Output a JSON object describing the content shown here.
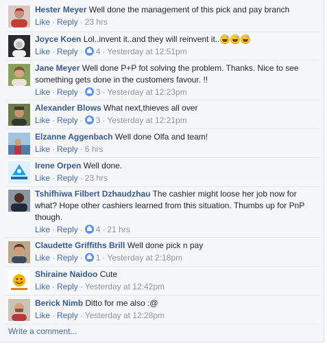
{
  "comments": [
    {
      "author": "Hester Meyer",
      "text": "Well done the management of this pick and pay branch",
      "like_label": "Like",
      "reply_label": "Reply",
      "likes": null,
      "time": "23 hrs"
    },
    {
      "author": "Joyce Koen",
      "text": "Lol..invent it..and they will reinvent it..",
      "like_label": "Like",
      "reply_label": "Reply",
      "likes": "4",
      "time": "Yesterday at 12:51pm",
      "emoji_icons": [
        "grinning-sweat-emoji",
        "grinning-sweat-emoji",
        "grinning-sweat-emoji"
      ]
    },
    {
      "author": "Jane Meyer",
      "text": "Well done P+P fot solving the problem. Thanks. Nice to see something gets done in the customers favour. !!",
      "like_label": "Like",
      "reply_label": "Reply",
      "likes": "3",
      "time": "Yesterday at 12:23pm"
    },
    {
      "author": "Alexander Blows",
      "text": "What next,thieves all over",
      "like_label": "Like",
      "reply_label": "Reply",
      "likes": "3",
      "time": "Yesterday at 12:21pm"
    },
    {
      "author": "Elzanne Aggenbach",
      "text": "Well done Olfa and team!",
      "like_label": "Like",
      "reply_label": "Reply",
      "likes": null,
      "time": "6 hrs"
    },
    {
      "author": "Irene Orpen",
      "text": "Well done.",
      "like_label": "Like",
      "reply_label": "Reply",
      "likes": null,
      "time": "23 hrs"
    },
    {
      "author": "Tshifhiwa Filbert Dzhaudzhau",
      "text": "The cashier might loose her job now for what? Hope other cashiers learned from this situation. Thumbs up for PnP though.",
      "like_label": "Like",
      "reply_label": "Reply",
      "likes": "4",
      "time": "21 hrs"
    },
    {
      "author": "Claudette Griffiths Brill",
      "text": "Well done pick n pay",
      "like_label": "Like",
      "reply_label": "Reply",
      "likes": "1",
      "time": "Yesterday at 2:18pm"
    },
    {
      "author": "Shiraine Naidoo",
      "text": "Cute",
      "like_label": "Like",
      "reply_label": "Reply",
      "likes": null,
      "time": "Yesterday at 12:42pm"
    },
    {
      "author": "Berick Nimb",
      "text": "Ditto for me also :@",
      "like_label": "Like",
      "reply_label": "Reply",
      "likes": null,
      "time": "Yesterday at 12:28pm"
    }
  ],
  "write_comment_label": "Write a comment...",
  "colors": {
    "author": "#365899",
    "link": "#4267b2",
    "meta": "#90949c",
    "like_badge": "#5890ff",
    "panel_bg": "#f6f7f9"
  },
  "icons": {
    "like_count": "thumbs-up-icon"
  }
}
